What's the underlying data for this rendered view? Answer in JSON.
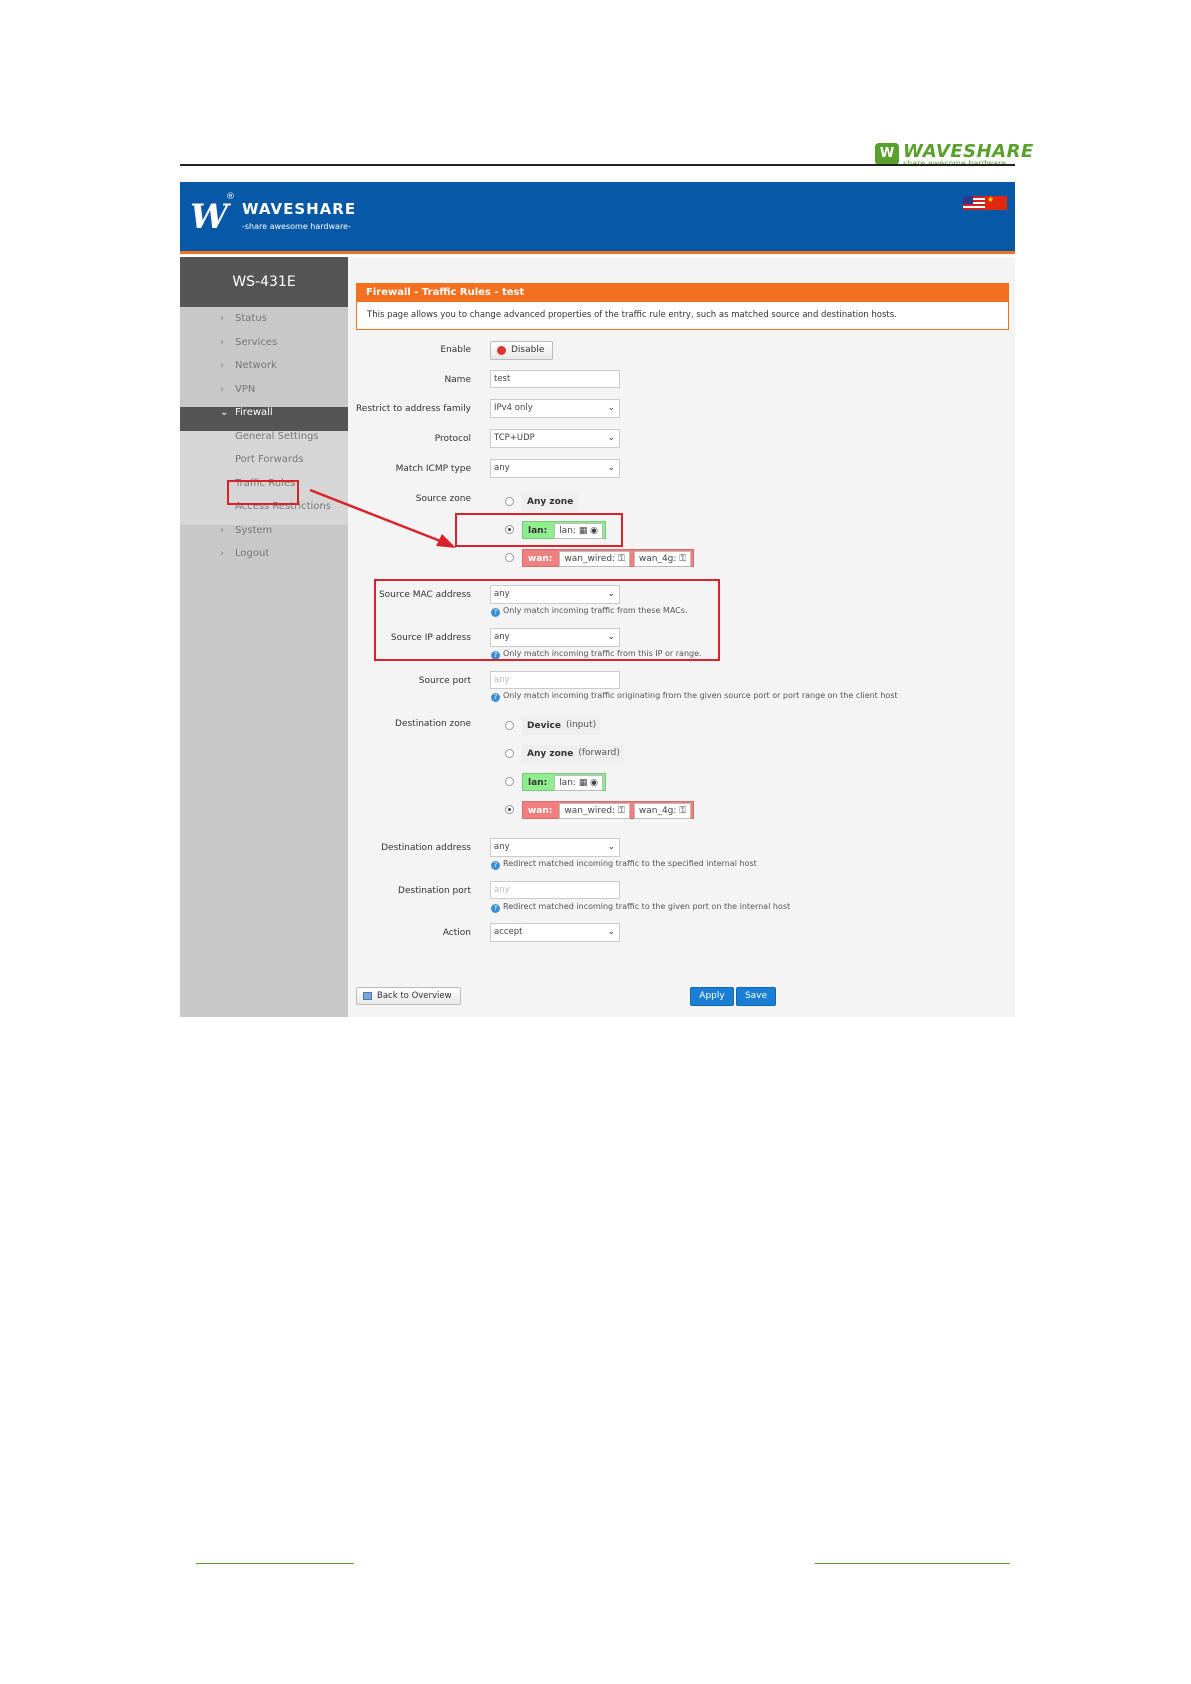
{
  "doc": {
    "logo_mark": "W",
    "logo_name": "WAVESHARE",
    "logo_tag": "share awesome hardware"
  },
  "header": {
    "brand_mark": "W",
    "brand_reg": "®",
    "brand_name": "WAVESHARE",
    "brand_tag": "-share awesome hardware-"
  },
  "sidebar": {
    "device": "WS-431E",
    "items": [
      {
        "label": "Status"
      },
      {
        "label": "Services"
      },
      {
        "label": "Network"
      },
      {
        "label": "VPN"
      },
      {
        "label": "Firewall"
      }
    ],
    "sub_items": [
      {
        "label": "General Settings"
      },
      {
        "label": "Port Forwards"
      },
      {
        "label": "Traffic Rules"
      },
      {
        "label": "Access Restrictions"
      }
    ],
    "bottom_items": [
      {
        "label": "System"
      },
      {
        "label": "Logout"
      }
    ]
  },
  "panel": {
    "title": "Firewall - Traffic Rules - test",
    "description": "This page allows you to change advanced properties of the traffic rule entry, such as matched source and destination hosts."
  },
  "form": {
    "enable_label": "Enable",
    "disable_button": "Disable",
    "name_label": "Name",
    "name_value": "test",
    "family_label": "Restrict to address family",
    "family_value": "IPv4 only",
    "protocol_label": "Protocol",
    "protocol_value": "TCP+UDP",
    "icmp_label": "Match ICMP type",
    "icmp_value": "any",
    "source_zone_label": "Source zone",
    "source_zones": {
      "any": "Any zone",
      "lan_name": "lan:",
      "lan_net": "lan:",
      "wan_name": "wan:",
      "wan_net1": "wan_wired:",
      "wan_net2": "wan_4g:"
    },
    "smac_label": "Source MAC address",
    "smac_value": "any",
    "smac_help": "Only match incoming traffic from these MACs.",
    "sip_label": "Source IP address",
    "sip_value": "any",
    "sip_help": "Only match incoming traffic from this IP or range.",
    "sport_label": "Source port",
    "sport_placeholder": "any",
    "sport_help": "Only match incoming traffic originating from the given source port or port range on the client host",
    "dest_zone_label": "Destination zone",
    "dest_zones": {
      "device": "Device",
      "device_sub": "(input)",
      "any": "Any zone",
      "any_sub": "(forward)",
      "lan_name": "lan:",
      "lan_net": "lan:",
      "wan_name": "wan:",
      "wan_net1": "wan_wired:",
      "wan_net2": "wan_4g:"
    },
    "daddr_label": "Destination address",
    "daddr_value": "any",
    "daddr_help": "Redirect matched incoming traffic to the specified internal host",
    "dport_label": "Destination port",
    "dport_placeholder": "any",
    "dport_help": "Redirect matched incoming traffic to the given port on the internal host",
    "action_label": "Action",
    "action_value": "accept"
  },
  "buttons": {
    "back": "Back to Overview",
    "apply": "Apply",
    "save": "Save"
  },
  "colors": {
    "header_blue": "#0858a8",
    "accent_orange": "#f37021",
    "highlight_red": "#d8232a",
    "zone_green": "#90ee90",
    "zone_red": "#f08080",
    "button_blue": "#1a7fd4"
  }
}
